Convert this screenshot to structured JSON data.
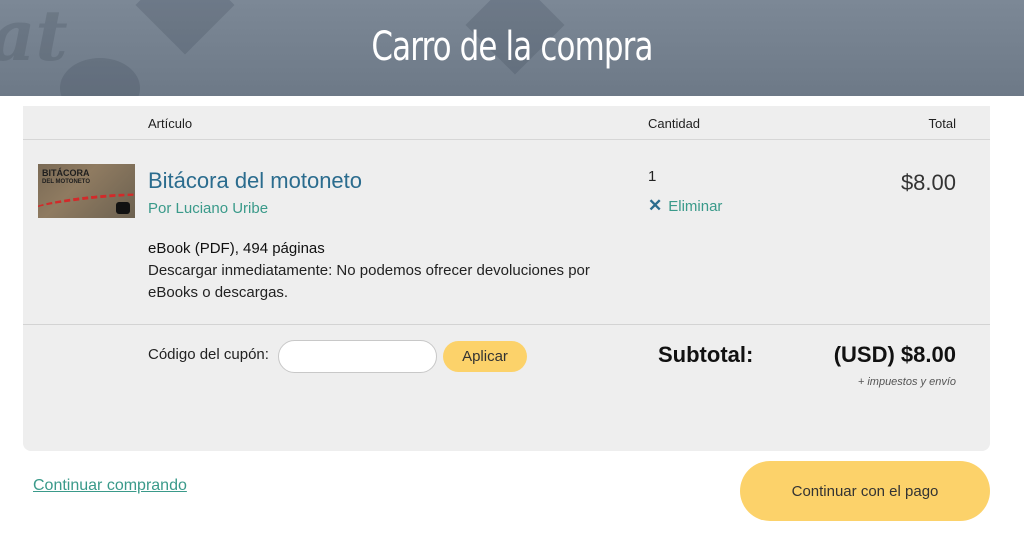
{
  "header": {
    "title": "Carro de la compra"
  },
  "table": {
    "col_article": "Artículo",
    "col_quantity": "Cantidad",
    "col_total": "Total"
  },
  "item": {
    "title": "Bitácora del motoneto",
    "author": "Por Luciano Uribe",
    "format": "eBook (PDF), 494 páginas",
    "note": "Descargar inmediatamente: No podemos ofrecer devoluciones por eBooks o descargas.",
    "quantity": "1",
    "remove_label": "Eliminar",
    "total": "$8.00",
    "cover_title_line1": "BITÁCORA",
    "cover_title_line2": "DEL MOTONETO"
  },
  "coupon": {
    "label": "Código del cupón:",
    "placeholder": "",
    "apply_label": "Aplicar"
  },
  "summary": {
    "subtotal_label": "Subtotal:",
    "subtotal_value": "(USD) $8.00",
    "tax_note": "+ impuestos y envío"
  },
  "actions": {
    "continue_shopping": "Continuar comprando",
    "checkout": "Continuar con el pago"
  },
  "colors": {
    "accent_button": "#fcd26a",
    "link_teal": "#3a9a8a",
    "title_blue": "#2b6c8e",
    "header_bg": "#7c8896"
  },
  "icons": {
    "remove": "close-icon"
  }
}
